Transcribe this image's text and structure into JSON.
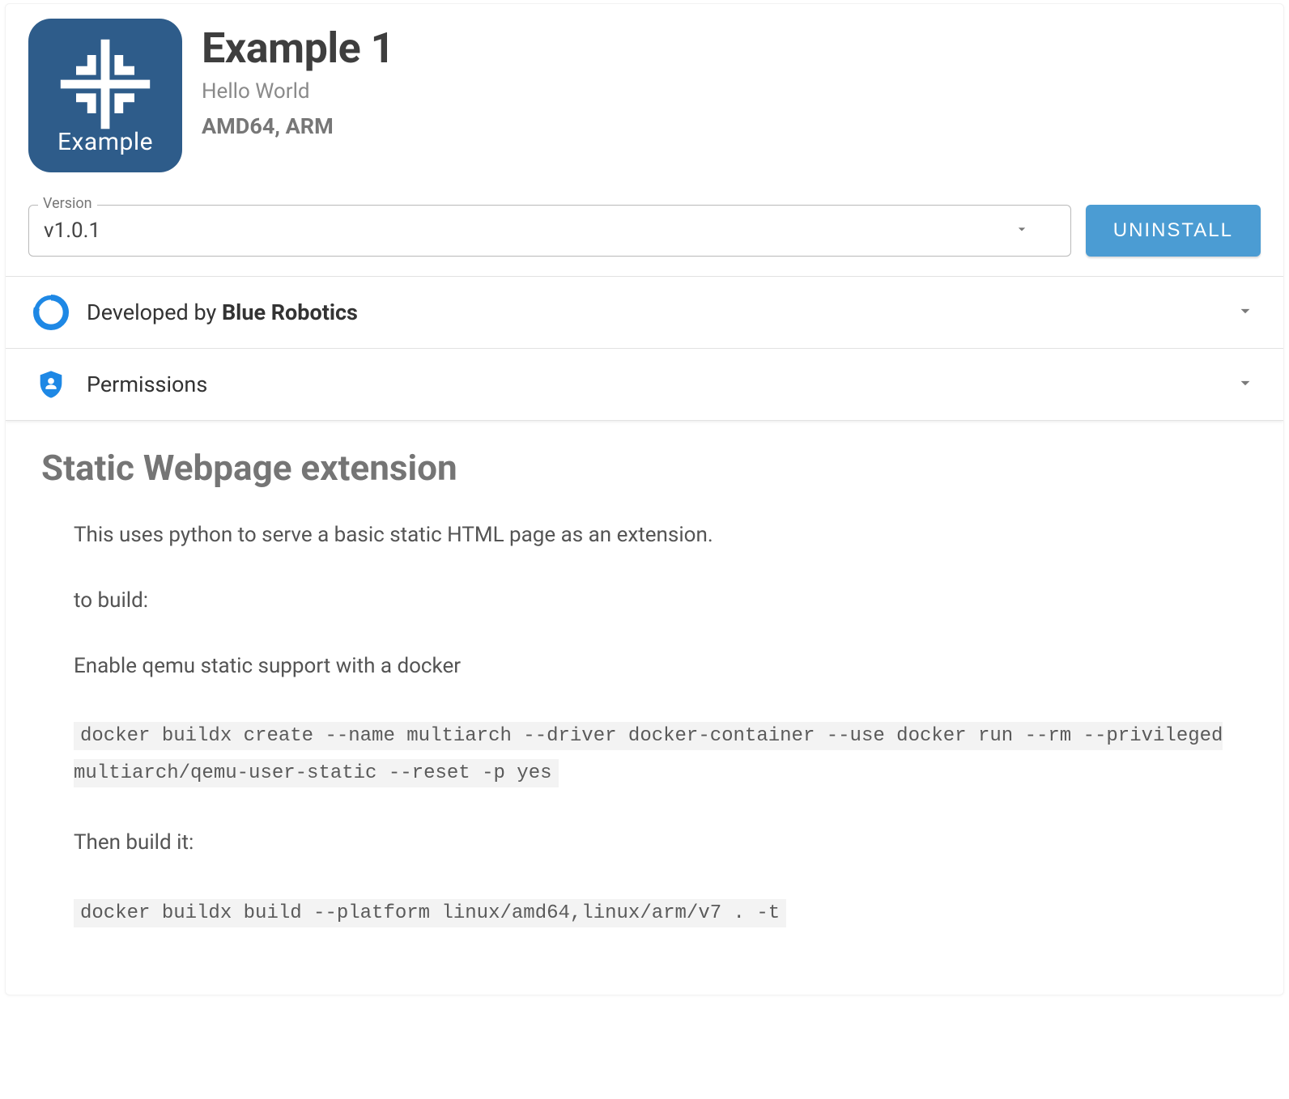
{
  "logo": {
    "caption": "Example"
  },
  "header": {
    "title": "Example 1",
    "subtitle": "Hello World",
    "architectures": "AMD64, ARM"
  },
  "version": {
    "legend": "Version",
    "selected": "v1.0.1"
  },
  "actions": {
    "uninstall": "UNINSTALL"
  },
  "accordion": {
    "developer_prefix": "Developed by ",
    "developer_name": "Blue Robotics",
    "permissions": "Permissions"
  },
  "content": {
    "heading": "Static Webpage extension",
    "p1": "This uses python to serve a basic static HTML page as an extension.",
    "p2": "to build:",
    "p3": "Enable qemu static support with a docker",
    "code1": "docker buildx create --name multiarch --driver docker-container --use docker run --rm --privileged multiarch/qemu-user-static --reset -p yes",
    "p4": "Then build it:",
    "code2": "docker buildx build --platform linux/amd64,linux/arm/v7 . -t"
  }
}
